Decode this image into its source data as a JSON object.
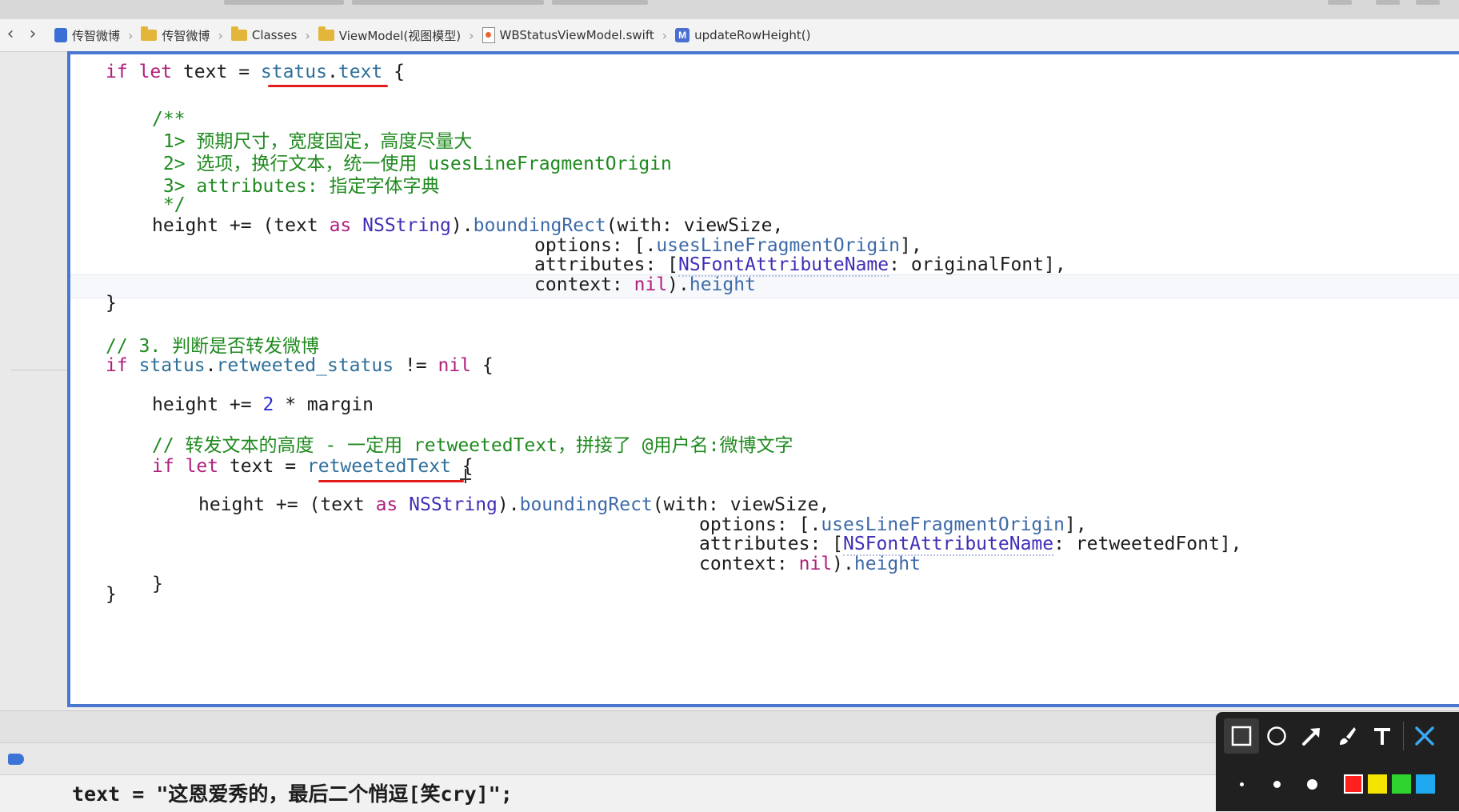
{
  "breadcrumbs": [
    {
      "label": "传智微博",
      "icon": "project-icon"
    },
    {
      "label": "传智微博",
      "icon": "folder-icon"
    },
    {
      "label": "Classes",
      "icon": "folder-icon"
    },
    {
      "label": "ViewModel(视图模型)",
      "icon": "folder-icon"
    },
    {
      "label": "WBStatusViewModel.swift",
      "icon": "swift-file-icon"
    },
    {
      "label": "updateRowHeight()",
      "icon": "method-icon"
    }
  ],
  "nav": {
    "back": "‹",
    "forward": "›"
  },
  "code": {
    "l1": {
      "a": "if",
      "b": " ",
      "c": "let",
      "d": " text = ",
      "e": "status",
      "f": ".",
      "g": "text",
      "h": " {"
    },
    "l2": "/**",
    "l3": " 1> 预期尺寸，宽度固定，高度尽量大",
    "l4": " 2> 选项，换行文本，统一使用 usesLineFragmentOrigin",
    "l5": " 3> attributes: 指定字体字典",
    "l6": " */",
    "l7": {
      "a": "height += (text ",
      "b": "as",
      "c": " ",
      "d": "NSString",
      "e": ").",
      "f": "boundingRect",
      "g": "(with: viewSize,"
    },
    "l8": {
      "a": "options: [.",
      "b": "usesLineFragmentOrigin",
      "c": "],"
    },
    "l9": {
      "a": "attributes: [",
      "b": "NSFontAttributeName",
      "c": ": originalFont],"
    },
    "l10": {
      "a": "context: ",
      "b": "nil",
      "c": ").",
      "d": "height"
    },
    "l11": "}",
    "l12": "// 3. 判断是否转发微博",
    "l13": {
      "a": "if",
      "b": " ",
      "c": "status",
      "d": ".",
      "e": "retweeted_status",
      "f": " != ",
      "g": "nil",
      "h": " {"
    },
    "l14": {
      "a": "height += ",
      "b": "2",
      "c": " * margin"
    },
    "l15": "// 转发文本的高度 - 一定用 retweetedText，拼接了 @用户名:微博文字",
    "l16": {
      "a": "if",
      "b": " ",
      "c": "let",
      "d": " text = ",
      "e": "retweetedText",
      "f": " {"
    },
    "l17": {
      "a": "height += (text ",
      "b": "as",
      "c": " ",
      "d": "NSString",
      "e": ").",
      "f": "boundingRect",
      "g": "(with: viewSize,"
    },
    "l18": {
      "a": "options: [.",
      "b": "usesLineFragmentOrigin",
      "c": "],"
    },
    "l19": {
      "a": "attributes: [",
      "b": "NSFontAttributeName",
      "c": ": retweetedFont],"
    },
    "l20": {
      "a": "context: ",
      "b": "nil",
      "c": ").",
      "d": "height"
    },
    "l21": "}",
    "l22": "}"
  },
  "console": {
    "line1": "text = \"这恩爱秀的，最后二个悄逗[笑cry]\";"
  },
  "annotation_toolbar": {
    "tools": [
      "rectangle-tool",
      "ellipse-tool",
      "arrow-tool",
      "brush-tool",
      "text-tool",
      "close"
    ],
    "sizes": [
      "small",
      "medium",
      "large"
    ],
    "colors": [
      "#ff1f1f",
      "#f4e400",
      "#2fd42f",
      "#1fa9f0"
    ]
  },
  "colors": {
    "editor_border": "#4a78d0",
    "annotation_underline": "#e21b1b"
  }
}
